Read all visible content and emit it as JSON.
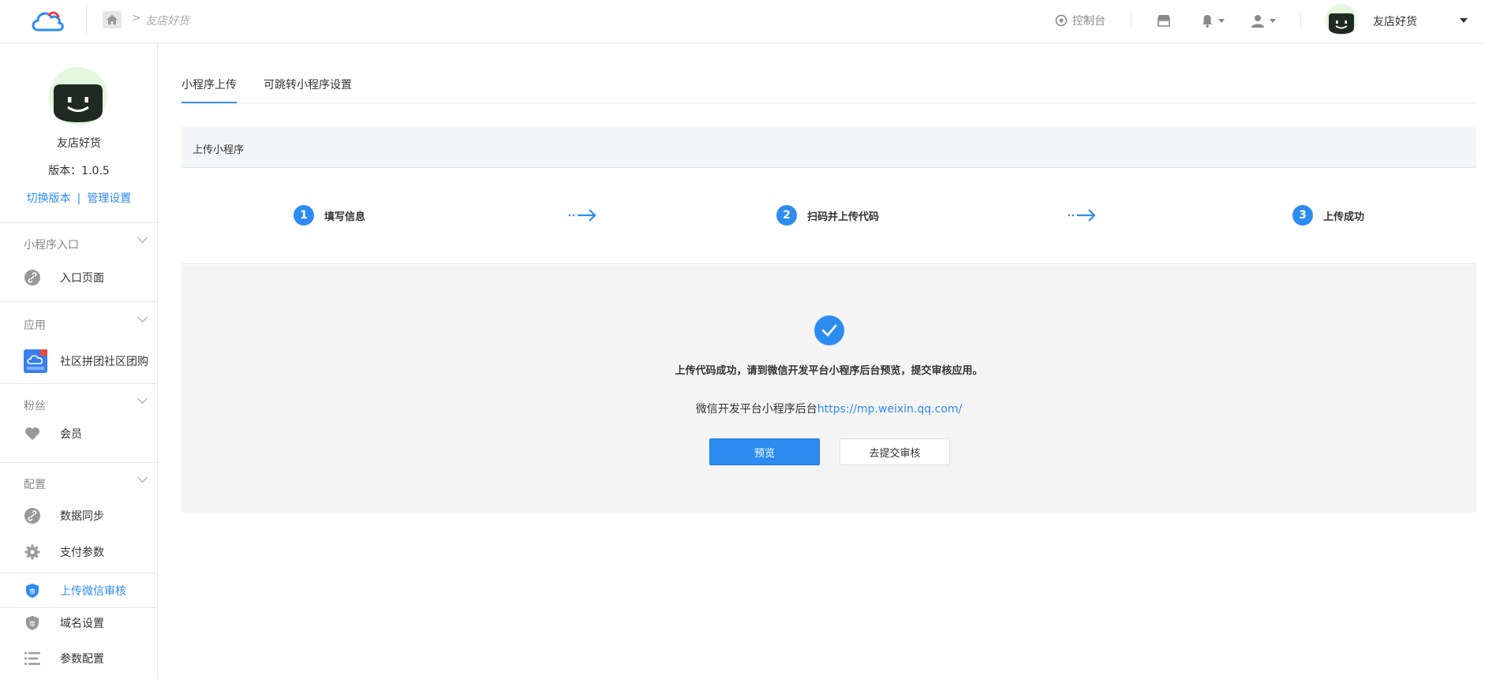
{
  "header": {
    "breadcrumb_sep": ">",
    "breadcrumb": "友店好货",
    "console_label": "控制台",
    "shop_name": "友店好货"
  },
  "profile": {
    "name": "友店好货",
    "version": "版本：1.0.5",
    "switch_version": "切换版本",
    "link_sep": "|",
    "manage_settings": "管理设置"
  },
  "sidebar": {
    "sections": [
      {
        "title": "小程序入口",
        "items": [
          {
            "label": "入口页面",
            "icon": "link-icon"
          }
        ]
      },
      {
        "title": "应用",
        "items": [
          {
            "label": "社区拼团社区团购",
            "icon": "community-groupbuy-app-icon"
          }
        ]
      },
      {
        "title": "粉丝",
        "items": [
          {
            "label": "会员",
            "icon": "heart-icon"
          }
        ]
      },
      {
        "title": "配置",
        "items": [
          {
            "label": "数据同步",
            "icon": "link-icon"
          },
          {
            "label": "支付参数",
            "icon": "gear-icon"
          },
          {
            "label": "上传微信审核",
            "icon": "shield-icon",
            "active": true
          },
          {
            "label": "域名设置",
            "icon": "shield-icon"
          },
          {
            "label": "参数配置",
            "icon": "list-icon"
          }
        ]
      }
    ]
  },
  "tabs": [
    {
      "label": "小程序上传",
      "active": true
    },
    {
      "label": "可跳转小程序设置",
      "active": false
    }
  ],
  "panel": {
    "title": "上传小程序",
    "steps": [
      {
        "num": "1",
        "label": "填写信息"
      },
      {
        "num": "2",
        "label": "扫码并上传代码"
      },
      {
        "num": "3",
        "label": "上传成功"
      }
    ],
    "result": {
      "message": "上传代码成功，请到微信开发平台小程序后台预览，提交审核应用。",
      "sub_prefix": "微信开发平台小程序后台",
      "sub_link": "https://mp.weixin.qq.com/",
      "preview_button": "预览",
      "submit_button": "去提交审核"
    }
  },
  "colors": {
    "accent": "#2d8cf0",
    "panel_bg": "#f4f4f4"
  }
}
